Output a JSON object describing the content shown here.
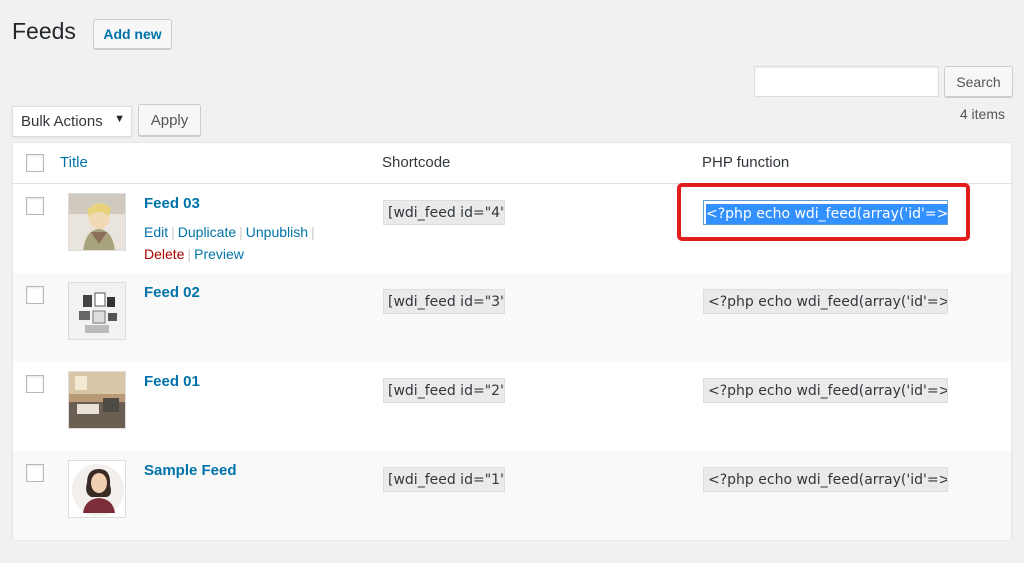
{
  "page": {
    "title": "Feeds",
    "add_new_label": "Add new"
  },
  "search": {
    "button_label": "Search",
    "value": ""
  },
  "toolbar": {
    "bulk_actions_label": "Bulk Actions",
    "apply_label": "Apply",
    "items_count": "4 items"
  },
  "table": {
    "columns": {
      "title": "Title",
      "shortcode": "Shortcode",
      "php_function": "PHP function"
    },
    "rows": [
      {
        "name": "Feed 03",
        "shortcode": "[wdi_feed id=\"4\"",
        "php": "<?php echo wdi_feed(array('id'=>",
        "actions": [
          "Edit",
          "Duplicate",
          "Unpublish",
          "Delete",
          "Preview"
        ]
      },
      {
        "name": "Feed 02",
        "shortcode": "[wdi_feed id=\"3\"",
        "php": "<?php echo wdi_feed(array('id'=>"
      },
      {
        "name": "Feed 01",
        "shortcode": "[wdi_feed id=\"2\"",
        "php": "<?php echo wdi_feed(array('id'=>"
      },
      {
        "name": "Sample Feed",
        "shortcode": "[wdi_feed id=\"1\"",
        "php": "<?php echo wdi_feed(array('id'=>"
      }
    ]
  },
  "colors": {
    "link": "#0073aa",
    "delete": "#a00000",
    "highlight": "#e31c1c",
    "selection": "#3390ff"
  }
}
